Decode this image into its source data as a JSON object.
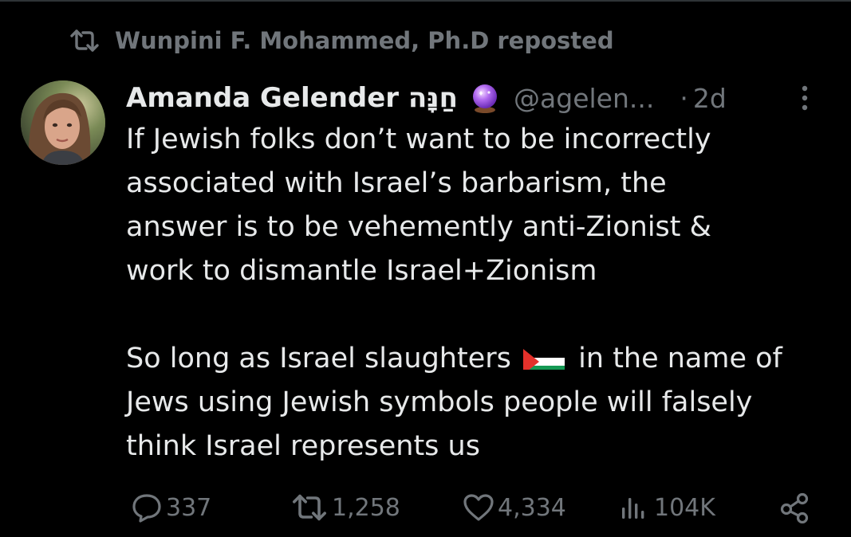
{
  "repost": {
    "icon": "repost-icon",
    "text": "Wunpini F. Mohammed, Ph.D reposted"
  },
  "tweet": {
    "author_name": "Amanda Gelender חַנָּה",
    "author_badge_icon": "crystal-ball-icon",
    "handle": "@agelen...",
    "separator": "·",
    "time": "2d",
    "more_icon": "more-options-icon",
    "paragraph1": [
      "If Jewish folks don’t want to be incorrectly",
      "associated with Israel’s barbarism, the",
      "answer is to be vehemently anti-Zionist &",
      "work to dismantle Israel+Zionism"
    ],
    "paragraph2": {
      "line1_before": "So long as Israel slaughters",
      "line1_emoji": "palestine-flag-icon",
      "line1_after": "in the name of",
      "line2": "Jews using Jewish symbols people will falsely",
      "line3": "think Israel represents us"
    }
  },
  "actions": {
    "replies": "337",
    "reposts": "1,258",
    "likes": "4,334",
    "views": "104K",
    "share_icon": "share-icon"
  },
  "colors": {
    "background": "#000000",
    "text_primary": "#e7e9ea",
    "text_secondary": "#71767b",
    "divider": "#2f3336"
  }
}
